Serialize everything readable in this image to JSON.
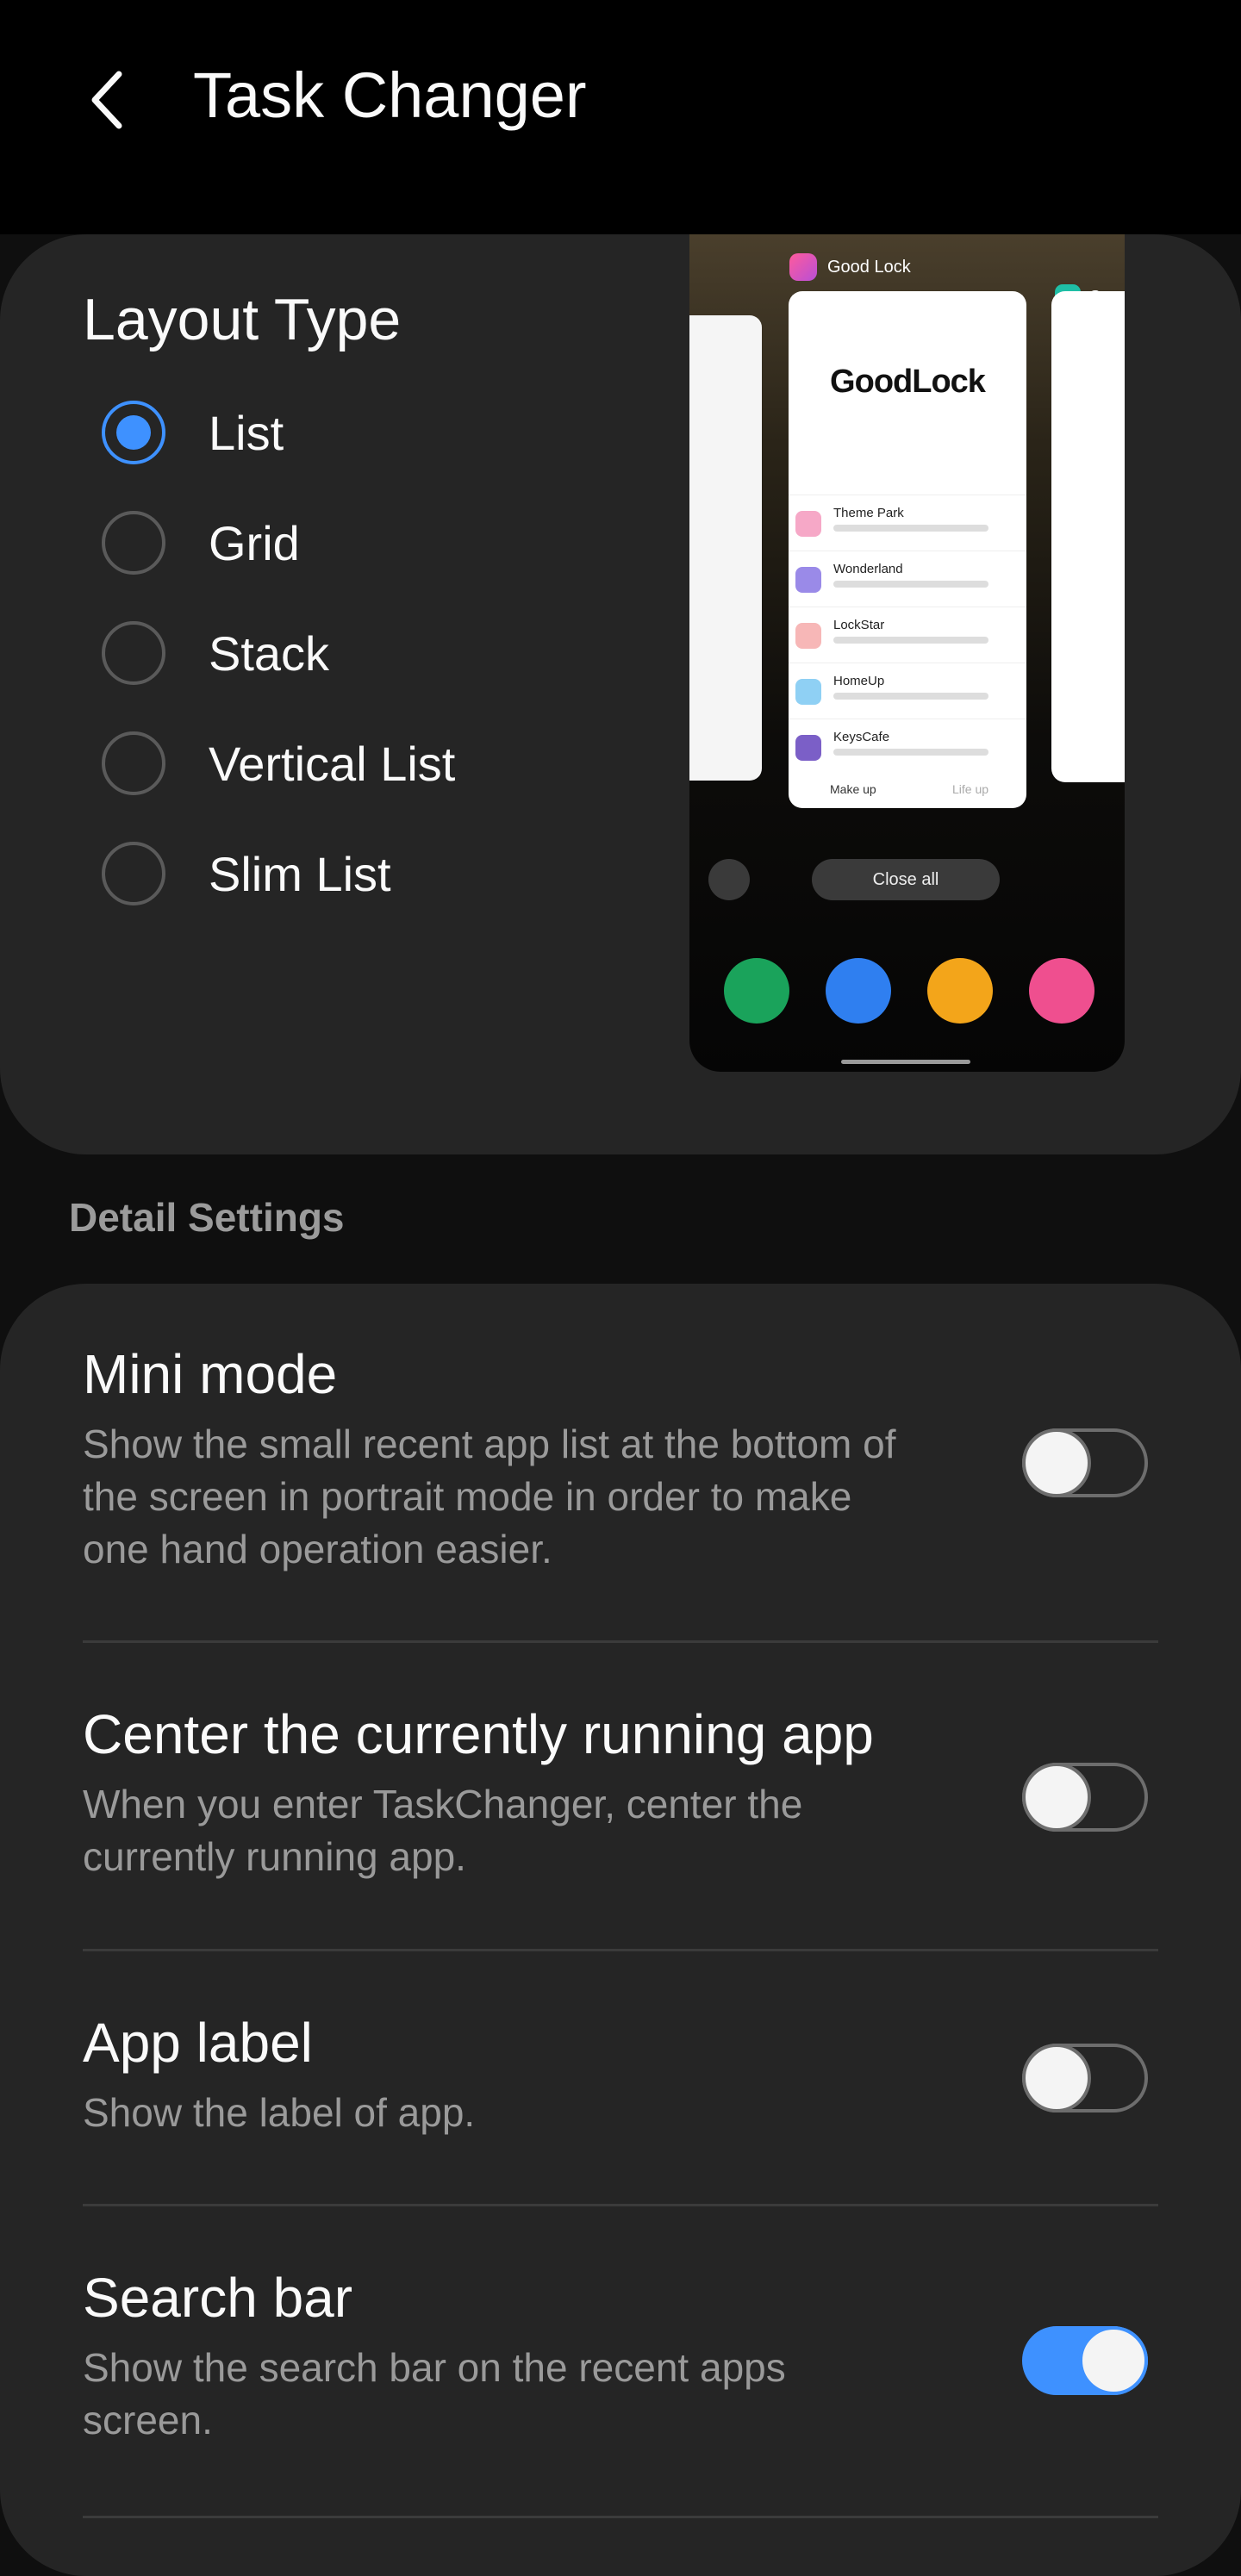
{
  "header": {
    "title": "Task Changer"
  },
  "layout": {
    "title": "Layout Type",
    "options": [
      {
        "label": "List",
        "selected": true
      },
      {
        "label": "Grid",
        "selected": false
      },
      {
        "label": "Stack",
        "selected": false
      },
      {
        "label": "Vertical List",
        "selected": false
      },
      {
        "label": "Slim List",
        "selected": false
      }
    ]
  },
  "preview": {
    "main_app": "Good Lock",
    "main_app_word": "GoodLock",
    "side_app": "Sams",
    "items": [
      "Theme Park",
      "Wonderland",
      "LockStar",
      "HomeUp",
      "KeysCafe"
    ],
    "bottom_tabs": [
      "Make up",
      "Life up"
    ],
    "close_all": "Close all",
    "dock_icons": [
      "phone-icon",
      "messages-icon",
      "files-icon",
      "good-lock-icon"
    ]
  },
  "detail": {
    "section_label": "Detail Settings",
    "settings": [
      {
        "title": "Mini mode",
        "desc": "Show the small recent app list at the bottom of the screen in portrait mode in order to make one hand operation easier.",
        "on": false
      },
      {
        "title": "Center the currently running app",
        "desc": "When you enter TaskChanger, center the currently running app.",
        "on": false
      },
      {
        "title": "App label",
        "desc": "Show the label of app.",
        "on": false
      },
      {
        "title": "Search bar",
        "desc": "Show the search bar on the recent apps screen.",
        "on": true
      }
    ]
  },
  "colors": {
    "accent": "#3e91ff",
    "background": "#0f0f0f",
    "card": "#252525"
  }
}
